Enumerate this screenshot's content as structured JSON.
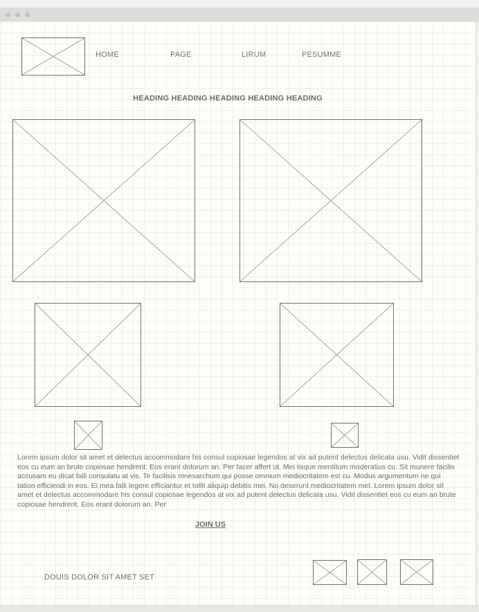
{
  "nav": {
    "items": [
      "HOME",
      "PAGE",
      "LIRUM",
      "PESUMME"
    ]
  },
  "heading": "HEADING HEADING HEADING HEADING HEADING",
  "body_text": "Lorem ipsum dolor sit amet et delectus accommodare his consul copiosae legendos at vix ad putent delectus delicata usu. Vidit dissentiet eos cu eum an brute copiosae hendrerit. Eos erant dolorum an. Per facer affert ut. Mei iisque mentitum moderatius cu. Sit munere facilis accusam eu dicat falli consulatu at vis. Te facilisis mnesarchum qui posse omnium mediocritatem est cu. Modus argumentum ne qui tation efficiendi in eos. Ei mea falli legere efficiantur et tollit aliquip debitis mei. No deserunt mediocritatem mel. Lorem ipsum dolor sit amet et delectus accommodare his consul copiosae legendos at vix ad putent delectus delicata usu. Vidit dissentiet eos cu eum an brute copiosae hendrerit. Eos erant dolorum an. Per",
  "cta": {
    "label": "JOIN US"
  },
  "footer": {
    "text": "DOUIS DOLOR SIT AMET SET"
  },
  "colors": {
    "canvas": "#fdfdfa",
    "grid": "#efefe9",
    "stroke": "#6f6f6f",
    "text": "#6e6e6e"
  }
}
